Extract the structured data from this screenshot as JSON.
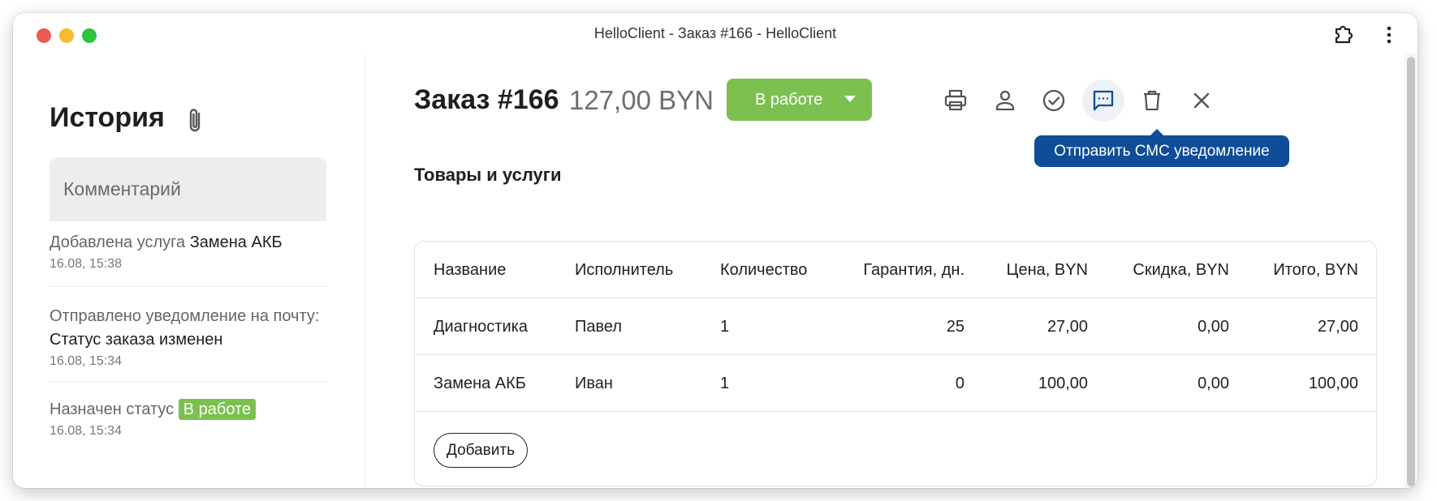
{
  "window": {
    "title": "HelloClient - Заказ #166 - HelloClient"
  },
  "sidebar": {
    "title": "История",
    "comment_placeholder": "Комментарий",
    "history": [
      {
        "prefix": "Добавлена услуга ",
        "highlight": "Замена АКБ",
        "time": "16.08, 15:38"
      },
      {
        "prefix": "Отправлено уведомление на почту: ",
        "highlight": "Статус заказа изменен",
        "time": "16.08, 15:34"
      },
      {
        "prefix": "Назначен статус ",
        "badge": "В работе",
        "time": "16.08, 15:34"
      }
    ]
  },
  "order": {
    "title": "Заказ #166",
    "sum": "127,00 BYN",
    "status": "В работе",
    "tooltip": "Отправить СМС уведомление",
    "section_title": "Товары и услуги",
    "add_button": "Добавить"
  },
  "toolbar": [
    {
      "icon": "printer-icon",
      "active": false
    },
    {
      "icon": "person-icon",
      "active": false
    },
    {
      "icon": "check-circle-icon",
      "active": false
    },
    {
      "icon": "message-icon",
      "active": true
    },
    {
      "icon": "trash-icon",
      "active": false
    },
    {
      "icon": "close-icon",
      "active": false
    }
  ],
  "table": {
    "headers": [
      "Название",
      "Исполнитель",
      "Количество",
      "Гарантия, дн.",
      "Цена, BYN",
      "Скидка, BYN",
      "Итого, BYN"
    ],
    "rows": [
      [
        "Диагностика",
        "Павел",
        "1",
        "25",
        "27,00",
        "0,00",
        "27,00"
      ],
      [
        "Замена АКБ",
        "Иван",
        "1",
        "0",
        "100,00",
        "0,00",
        "100,00"
      ]
    ]
  },
  "colors": {
    "status_green": "#7cc04f",
    "tooltip_blue": "#0f4d99"
  }
}
